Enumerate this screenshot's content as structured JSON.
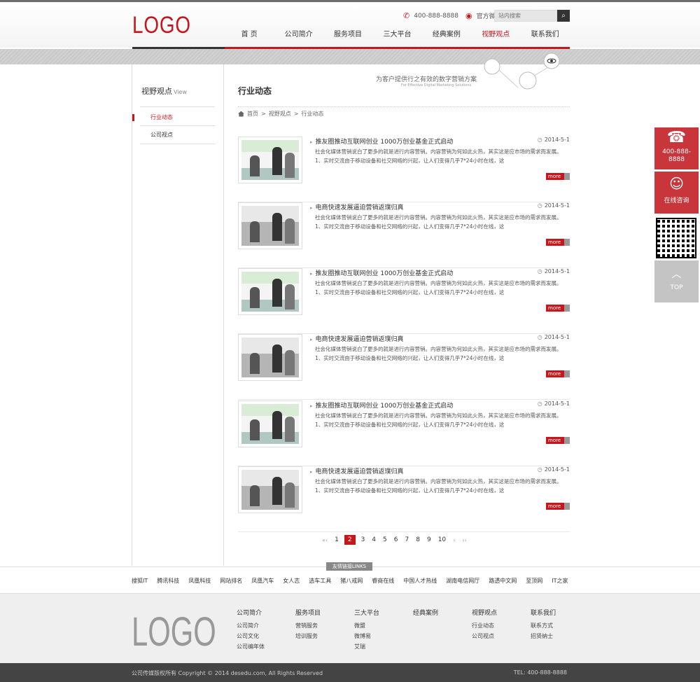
{
  "header": {
    "logo": "LOGO",
    "phone": "400-888-8888",
    "weibo": "官方微博",
    "search_placeholder": "站内搜索"
  },
  "nav": [
    "首 页",
    "公司简介",
    "服务项目",
    "三大平台",
    "经典案例",
    "视野观点",
    "联系我们"
  ],
  "banner": {
    "slogan": "为客户提供行之有效的数字营销方案",
    "slogan_en": "For Effective Digital Marketing Solutions"
  },
  "sidebar": {
    "title": "视野观点",
    "title_en": "View",
    "items": [
      "行业动态",
      "公司视点"
    ]
  },
  "main": {
    "title": "行业动态",
    "breadcrumb": [
      "首页",
      ">",
      "视野观点",
      ">",
      "行业动态"
    ],
    "more_label": "more",
    "articles": [
      {
        "title": "推友圈推动互联网创业 1000万创业基金正式启动",
        "date": "2014-5-1",
        "body": "社会化媒体营销说白了更多的就是进行内容营销。内容营销为何如此火热，其实这是应市场的需求而发展。1、实时交流由于移动设备和社交网络的兴起，让人们变得几乎7*24小时在线，这"
      },
      {
        "title": "电商快速发展逼迫营销返璞归真",
        "date": "2014-5-1",
        "body": "社会化媒体营销说白了更多的就是进行内容营销。内容营销为何如此火热，其实这是应市场的需求而发展。1、实时交流由于移动设备和社交网络的兴起，让人们变得几乎7*24小时在线，这"
      },
      {
        "title": "推友圈推动互联网创业 1000万创业基金正式启动",
        "date": "2014-5-1",
        "body": "社会化媒体营销说白了更多的就是进行内容营销。内容营销为何如此火热，其实这是应市场的需求而发展。1、实时交流由于移动设备和社交网络的兴起，让人们变得几乎7*24小时在线，这"
      },
      {
        "title": "电商快速发展逼迫营销返璞归真",
        "date": "2014-5-1",
        "body": "社会化媒体营销说白了更多的就是进行内容营销。内容营销为何如此火热，其实这是应市场的需求而发展。1、实时交流由于移动设备和社交网络的兴起，让人们变得几乎7*24小时在线，这"
      },
      {
        "title": "推友圈推动互联网创业 1000万创业基金正式启动",
        "date": "2014-5-1",
        "body": "社会化媒体营销说白了更多的就是进行内容营销。内容营销为何如此火热，其实这是应市场的需求而发展。1、实时交流由于移动设备和社交网络的兴起，让人们变得几乎7*24小时在线，这"
      },
      {
        "title": "电商快速发展逼迫营销返璞归真",
        "date": "2014-5-1",
        "body": "社会化媒体营销说白了更多的就是进行内容营销。内容营销为何如此火热，其实这是应市场的需求而发展。1、实时交流由于移动设备和社交网络的兴起，让人们变得几乎7*24小时在线，这"
      }
    ]
  },
  "pagination": {
    "first": "«‹",
    "prev": "‹",
    "pages": [
      "1",
      "2",
      "3",
      "4",
      "5",
      "6",
      "7",
      "8",
      "9",
      "10"
    ],
    "current": "2",
    "next": "›",
    "last": "››"
  },
  "links": {
    "tag": "友情链接LINKS",
    "items": [
      "搜狐IT",
      "腾讯科技",
      "凤凰科技",
      "网站排名",
      "凤凰汽车",
      "女人志",
      "选车工具",
      "猪八戒网",
      "睿商在线",
      "中国人才热线",
      "湖南电信网厅",
      "路透中文网",
      "至顶网",
      "IT之家"
    ]
  },
  "footer": {
    "logo": "LOGO",
    "columns": [
      {
        "title": "公司简介",
        "items": [
          "公司简介",
          "公司文化",
          "公司编年体"
        ]
      },
      {
        "title": "服务项目",
        "items": [
          "营销服务",
          "培训服务"
        ]
      },
      {
        "title": "三大平台",
        "items": [
          "微盟",
          "微博易",
          "艾瑞"
        ]
      },
      {
        "title": "经典案例",
        "items": []
      },
      {
        "title": "视野观点",
        "items": [
          "行业动态",
          "公司视点"
        ]
      },
      {
        "title": "联系我们",
        "items": [
          "联系方式",
          "招贤纳士"
        ]
      }
    ],
    "copyright": "公司传媒版权所有 Copyright © 2014 desedu.com, All Rights Reserved",
    "tel": "TEL: 400-888-8888"
  },
  "floatbar": {
    "phone": "400-888-8888",
    "chat": "在线咨询",
    "top": "TOP"
  },
  "colors": {
    "accent": "#c8161d"
  }
}
